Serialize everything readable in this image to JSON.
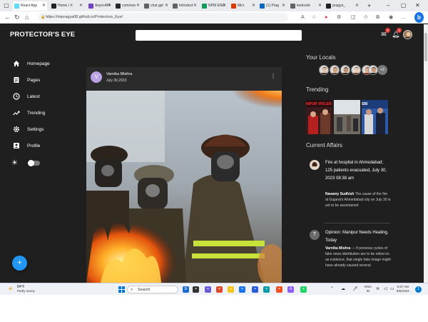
{
  "browser": {
    "tabs": [
      {
        "label": "React App",
        "favicon_color": "#61dafb",
        "active": true
      },
      {
        "label": "Home / X",
        "favicon_color": "#222222"
      },
      {
        "label": "AsyncAPI",
        "favicon_color": "#6f42c1"
      },
      {
        "label": "commun",
        "favicon_color": "#24292f"
      },
      {
        "label": "chat gpt",
        "favicon_color": "#5f6368"
      },
      {
        "label": "Introduct",
        "favicon_color": "#5f6368"
      },
      {
        "label": "NPM ENC",
        "favicon_color": "#0f9d58"
      },
      {
        "label": "Micr",
        "favicon_color": "#d83b01"
      },
      {
        "label": "(1) Prag",
        "favicon_color": "#0a66c2"
      },
      {
        "label": "leetcode",
        "favicon_color": "#5f6368"
      },
      {
        "label": "pragya_",
        "favicon_color": "#202124"
      }
    ],
    "url": "https://impragya08.github.io/Protectors_Eye/"
  },
  "app": {
    "brand": "PROTECTOR'S EYE",
    "search_placeholder": "",
    "mail_badge": "4",
    "notif_badge": "2",
    "accent": "#2196f3"
  },
  "sidebar": {
    "items": [
      {
        "label": "Homepage",
        "icon": "home-icon"
      },
      {
        "label": "Pages",
        "icon": "pages-icon"
      },
      {
        "label": "Latest",
        "icon": "clock-icon"
      },
      {
        "label": "Trending",
        "icon": "trending-icon"
      },
      {
        "label": "Settings",
        "icon": "gear-icon"
      },
      {
        "label": "Profile",
        "icon": "profile-icon"
      }
    ],
    "fab_label": "+"
  },
  "post": {
    "avatar_letter": "V",
    "author": "Varnika Mishra",
    "date": "July 30,2023"
  },
  "right": {
    "locals_title": "Your Locals",
    "locals_more": "+3",
    "trending_title": "Trending",
    "trending_tags": [
      "NIPUR VIOLEN",
      "",
      "SBI"
    ],
    "current_title": "Current Affairs",
    "news": [
      {
        "title": "Fire at hospital in Ahmedabad; 125 patients evacuated, July 30, 2023 08:38 am",
        "author": "Navamy Sudhish",
        "body": "The cause of the fire at Gujarat's Ahmedabad city on July 30 is yet to be ascertained"
      },
      {
        "avatar_letter": "T",
        "title": "Opinion: Manipur Needs Healing, Today",
        "author": "Varnika Mishra",
        "body": "— If previous cycles of fake news distribution are to be relied on as evidence, that single fake image might have already caused several"
      }
    ]
  },
  "taskbar": {
    "temp": "84°F",
    "weather": "Partly sunny",
    "search": "Search",
    "lang_1": "ENG",
    "lang_2": "IN",
    "time": "9:37 AM",
    "date": "8/6/2023",
    "notif_count": "1"
  }
}
